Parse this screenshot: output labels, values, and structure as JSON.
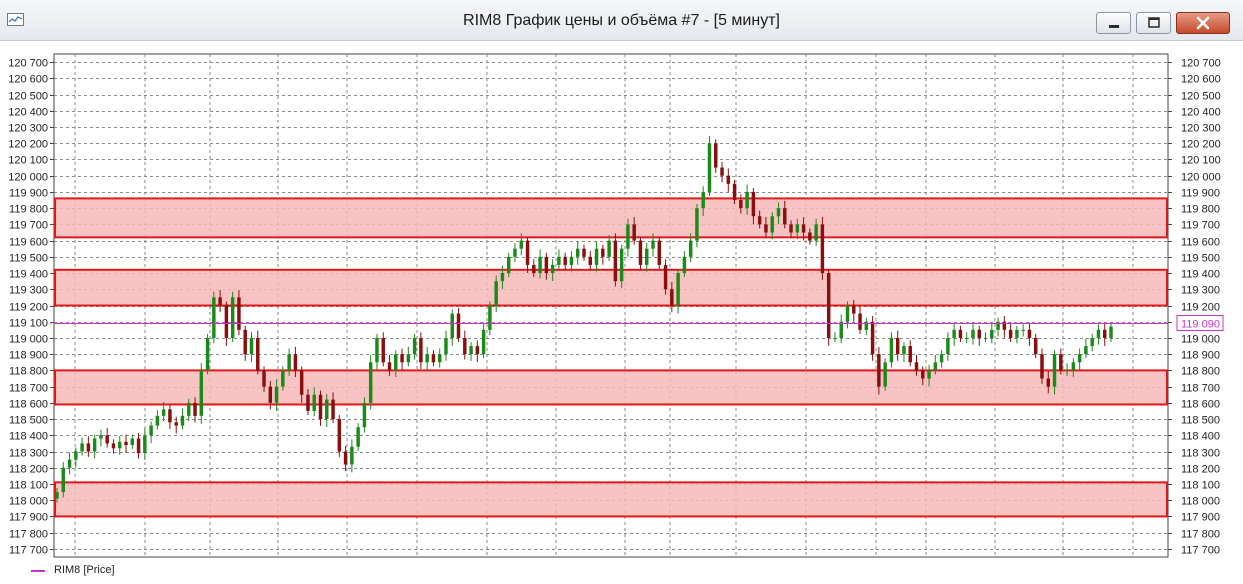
{
  "window": {
    "title": "RIM8 График цены и объёма #7 - [5 минут]",
    "controls": {
      "minimize": "minimize",
      "maximize": "maximize",
      "close": "close"
    }
  },
  "legend": {
    "label": "RIM8 [Price]",
    "color": "#cc33cc"
  },
  "chart_data": {
    "type": "candlestick",
    "title": "",
    "ylim": [
      117650,
      120750
    ],
    "yticks": [
      117700,
      117800,
      117900,
      118000,
      118100,
      118200,
      118300,
      118400,
      118500,
      118600,
      118700,
      118800,
      118900,
      119000,
      119100,
      119200,
      119300,
      119400,
      119500,
      119600,
      119700,
      119800,
      119900,
      120000,
      120100,
      120200,
      120300,
      120400,
      120500,
      120600,
      120700
    ],
    "ytick_labels": [
      "117 700",
      "117 800",
      "117 900",
      "118 000",
      "118 100",
      "118 200",
      "118 300",
      "118 400",
      "118 500",
      "118 600",
      "118 700",
      "118 800",
      "118 900",
      "119 000",
      "119 100",
      "119 200",
      "119 300",
      "119 400",
      "119 500",
      "119 600",
      "119 700",
      "119 800",
      "119 900",
      "120 000",
      "120 100",
      "120 200",
      "120 300",
      "120 400",
      "120 500",
      "120 600",
      "120 700"
    ],
    "current_price": 119090,
    "current_price_label": "119 090",
    "colors": {
      "up": "#1a8a1a",
      "down": "#8b0d0d",
      "zone_fill": "#f7b9b9",
      "zone_border": "#e01818",
      "price_line": "#cc33cc",
      "grid": "#8a8a8a"
    },
    "zones": [
      {
        "from": 119620,
        "to": 119860
      },
      {
        "from": 119200,
        "to": 119420
      },
      {
        "from": 118590,
        "to": 118800
      },
      {
        "from": 117900,
        "to": 118110
      }
    ],
    "closes": [
      118050,
      118200,
      118250,
      118300,
      118350,
      118300,
      118380,
      118400,
      118350,
      118320,
      118360,
      118340,
      118380,
      118290,
      118400,
      118460,
      118520,
      118560,
      118480,
      118460,
      118520,
      118600,
      118520,
      118800,
      119000,
      119250,
      119200,
      119000,
      119250,
      119050,
      118900,
      119000,
      118800,
      118700,
      118600,
      118700,
      118800,
      118900,
      118800,
      118650,
      118550,
      118650,
      118500,
      118620,
      118500,
      118300,
      118220,
      118330,
      118450,
      118600,
      118850,
      119000,
      118850,
      118800,
      118900,
      118850,
      118900,
      119000,
      118850,
      118900,
      118850,
      118900,
      119000,
      119150,
      119000,
      118900,
      118950,
      118900,
      119050,
      119200,
      119350,
      119400,
      119500,
      119550,
      119600,
      119450,
      119400,
      119500,
      119400,
      119450,
      119500,
      119450,
      119500,
      119550,
      119500,
      119450,
      119550,
      119500,
      119600,
      119350,
      119550,
      119700,
      119600,
      119450,
      119550,
      119600,
      119450,
      119300,
      119200,
      119400,
      119500,
      119600,
      119800,
      119900,
      120200,
      120050,
      120000,
      119950,
      119850,
      119800,
      119900,
      119750,
      119700,
      119650,
      119750,
      119800,
      119700,
      119650,
      119700,
      119650,
      119600,
      119700,
      119400,
      119000,
      119000,
      119100,
      119200,
      119150,
      119050,
      119100,
      118900,
      118700,
      118850,
      119000,
      118900,
      118950,
      118850,
      118800,
      118750,
      118800,
      118850,
      118900,
      119000,
      119050,
      119000,
      119000,
      119050,
      119000,
      119000,
      119050,
      119100,
      119050,
      119000,
      119050,
      119050,
      119000,
      118900,
      118750,
      118700,
      118900,
      118800,
      118800,
      118850,
      118900,
      118950,
      119000,
      119050,
      119000,
      119070
    ]
  }
}
